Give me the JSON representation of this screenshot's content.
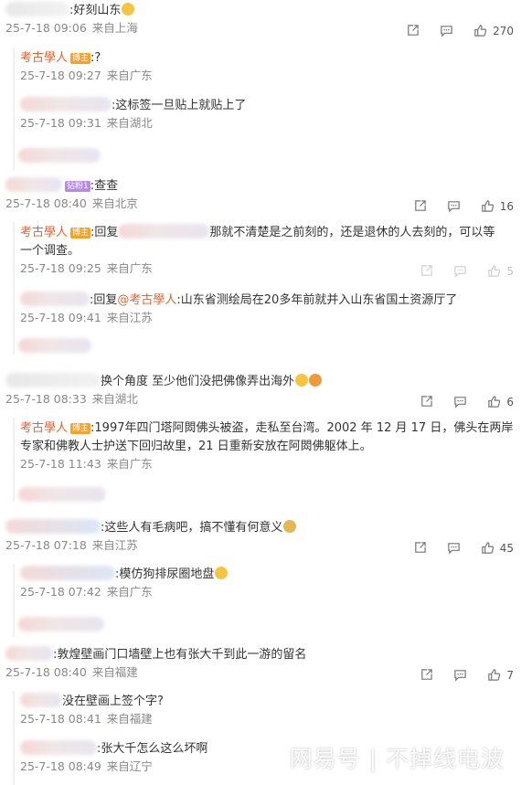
{
  "comments": [
    {
      "text": ":好刻山东",
      "time": "25-7-18 09:06",
      "location": "来自上海",
      "likes": "270",
      "replies": [
        {
          "name": "考古學人",
          "badge": "博主",
          "text": ":?",
          "time": "25-7-18 09:27",
          "location": "来自广东"
        },
        {
          "text": ":这标签一旦贴上就贴上了",
          "time": "25-7-18 09:31",
          "location": "来自湖北"
        }
      ]
    },
    {
      "badge": "钻粉1",
      "text": ":查查",
      "time": "25-7-18 08:40",
      "location": "来自北京",
      "likes": "16",
      "replies": [
        {
          "name": "考古學人",
          "badge": "博主",
          "reply_prefix": ":回复",
          "text": "那就不清楚是之前刻的，还是退休的人去刻的，可以等",
          "text2": "一个调查。",
          "time": "25-7-18 09:25",
          "location": "来自广东",
          "likes": "5"
        },
        {
          "reply_prefix": ":回复",
          "reply_to": "@考古學人",
          "text": ":山东省测绘局在20多年前就并入山东省国土资源厅了",
          "time": "25-7-18 09:41",
          "location": "来自江苏"
        }
      ]
    },
    {
      "text": "换个角度 至少他们没把佛像弄出海外",
      "time": "25-7-18 08:33",
      "location": "来自湖北",
      "likes": "6",
      "replies": [
        {
          "name": "考古學人",
          "badge": "博主",
          "text": ":1997年四门塔阿閦佛头被盗，走私至台湾。2002 年 12 月 17 日，佛头在两岸",
          "text2": "专家和佛教人士护送下回归故里，21 日重新安放在阿閦佛躯体上。",
          "time": "25-7-18 11:43",
          "location": "来自广东"
        }
      ]
    },
    {
      "text": ":这些人有毛病吧，搞不懂有何意义",
      "time": "25-7-18 07:18",
      "location": "来自江苏",
      "likes": "45",
      "replies": [
        {
          "text": ":模仿狗排尿圈地盘",
          "time": "25-7-18 07:42",
          "location": "来自广东"
        }
      ]
    },
    {
      "text": ":敦煌壁画门口墙壁上也有张大千到此一游的留名",
      "time": "25-7-18 08:40",
      "location": "来自福建",
      "likes": "7",
      "replies": [
        {
          "text": "没在壁画上签个字?",
          "time": "25-7-18 08:41",
          "location": "来自福建"
        },
        {
          "text": ":张大千怎么这么坏啊",
          "time": "25-7-18 08:49",
          "location": "来自辽宁"
        }
      ]
    }
  ],
  "watermark": "网易号 | 不掉线电波",
  "colors": {
    "author": "#e8602c",
    "badge": "#f7a128",
    "badge_purple": "#b58ae8",
    "meta": "#888888"
  },
  "icons": {
    "share": "share-icon",
    "comment": "comment-icon",
    "like": "like-icon"
  }
}
